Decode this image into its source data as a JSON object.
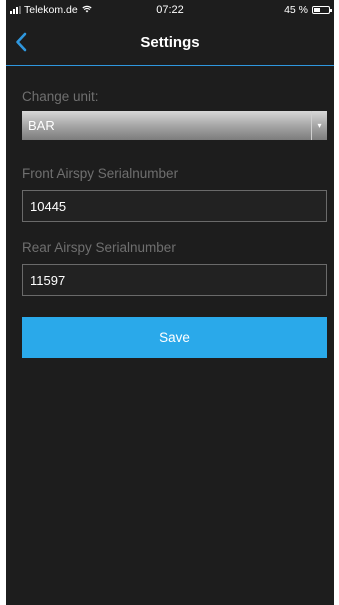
{
  "status_bar": {
    "carrier": "Telekom.de",
    "time": "07:22",
    "battery_percent": "45 %",
    "battery_level": 0.45,
    "signal_icon": "signal-bars-icon",
    "wifi_icon": "wifi-icon",
    "battery_icon": "battery-icon"
  },
  "nav": {
    "title": "Settings",
    "back_icon": "chevron-left-icon",
    "accent_color": "#2f97de"
  },
  "form": {
    "unit_label": "Change unit:",
    "unit_selected": "BAR",
    "front_label": "Front Airspy Serialnumber",
    "front_value": "10445",
    "rear_label": "Rear Airspy Serialnumber",
    "rear_value": "11597",
    "save_label": "Save",
    "save_color": "#2aa9ea"
  }
}
